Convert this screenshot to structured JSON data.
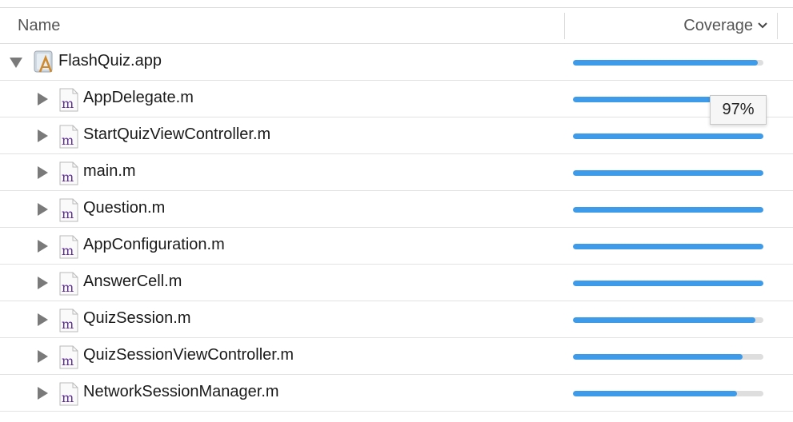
{
  "header": {
    "name_label": "Name",
    "coverage_label": "Coverage",
    "sort_icon": "chevron-down-icon"
  },
  "tooltip": {
    "text": "97%"
  },
  "colors": {
    "bar_fill": "#3e9be9",
    "bar_track": "#dedede",
    "file_m_glyph": "#5b2d8f"
  },
  "rows": [
    {
      "label": "FlashQuiz.app",
      "icon": "app-icon",
      "expanded": true,
      "coverage": 0.97
    },
    {
      "label": "AppDelegate.m",
      "icon": "objc-file-icon",
      "icon_glyph": "m",
      "expanded": false,
      "coverage": 0.97
    },
    {
      "label": "StartQuizViewController.m",
      "icon": "objc-file-icon",
      "icon_glyph": "m",
      "expanded": false,
      "coverage": 1.0
    },
    {
      "label": "main.m",
      "icon": "objc-file-icon",
      "icon_glyph": "m",
      "expanded": false,
      "coverage": 1.0
    },
    {
      "label": "Question.m",
      "icon": "objc-file-icon",
      "icon_glyph": "m",
      "expanded": false,
      "coverage": 1.0
    },
    {
      "label": "AppConfiguration.m",
      "icon": "objc-file-icon",
      "icon_glyph": "m",
      "expanded": false,
      "coverage": 1.0
    },
    {
      "label": "AnswerCell.m",
      "icon": "objc-file-icon",
      "icon_glyph": "m",
      "expanded": false,
      "coverage": 1.0
    },
    {
      "label": "QuizSession.m",
      "icon": "objc-file-icon",
      "icon_glyph": "m",
      "expanded": false,
      "coverage": 0.96
    },
    {
      "label": "QuizSessionViewController.m",
      "icon": "objc-file-icon",
      "icon_glyph": "m",
      "expanded": false,
      "coverage": 0.89
    },
    {
      "label": "NetworkSessionManager.m",
      "icon": "objc-file-icon",
      "icon_glyph": "m",
      "expanded": false,
      "coverage": 0.86
    }
  ]
}
